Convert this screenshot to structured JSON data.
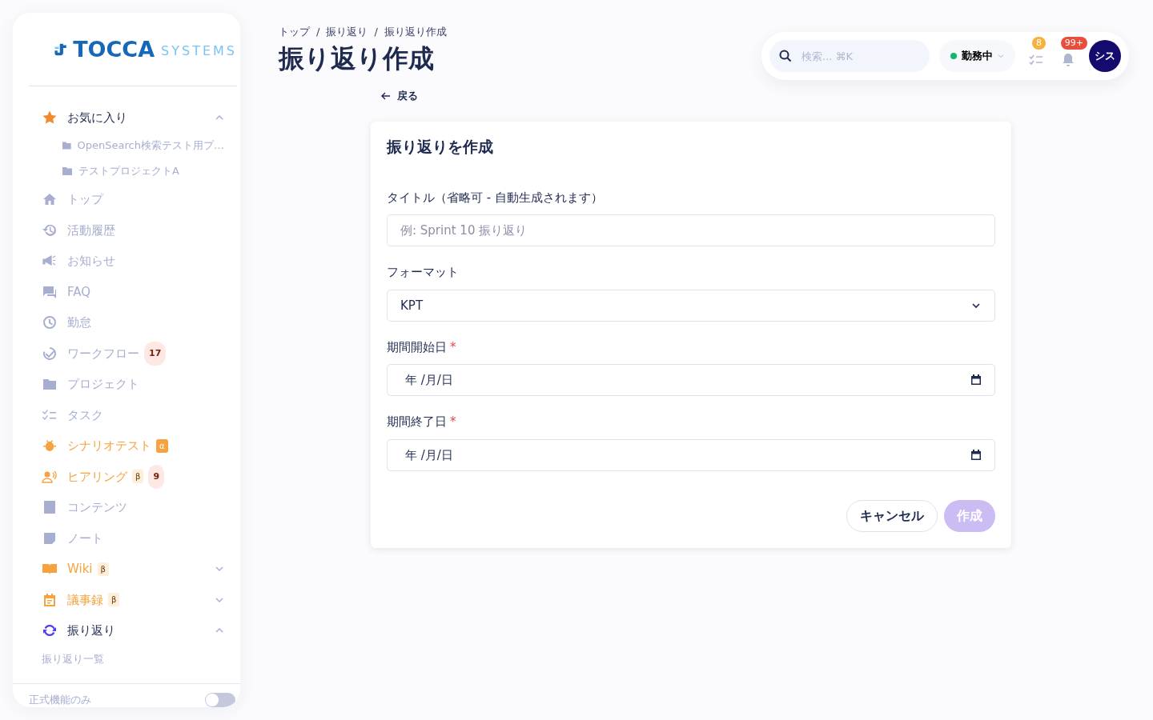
{
  "brand": {
    "name": "TOCCA",
    "sub": "SYSTEMS"
  },
  "sidebar": {
    "items": [
      {
        "kind": "group",
        "label": "お気に入り",
        "color": "#f08a2c",
        "expanded": true,
        "children": [
          {
            "label": "OpenSearch検索テスト用プ…"
          },
          {
            "label": "テストプロジェクトA"
          }
        ]
      },
      {
        "kind": "link",
        "label": "トップ",
        "color": "#a7aed0"
      },
      {
        "kind": "link",
        "label": "活動履歴",
        "color": "#a7aed0"
      },
      {
        "kind": "link",
        "label": "お知らせ",
        "color": "#a7aed0"
      },
      {
        "kind": "link",
        "label": "FAQ",
        "color": "#a7aed0"
      },
      {
        "kind": "link",
        "label": "勤怠",
        "color": "#a7aed0"
      },
      {
        "kind": "link",
        "label": "ワークフロー",
        "color": "#a7aed0",
        "count": "17"
      },
      {
        "kind": "link",
        "label": "プロジェクト",
        "color": "#a7aed0"
      },
      {
        "kind": "link",
        "label": "タスク",
        "color": "#a7aed0"
      },
      {
        "kind": "link",
        "label": "シナリオテスト",
        "color": "#f5a340",
        "tag": "α"
      },
      {
        "kind": "link",
        "label": "ヒアリング",
        "color": "#f5a340",
        "tag": "β",
        "count": "9"
      },
      {
        "kind": "link",
        "label": "コンテンツ",
        "color": "#a7aed0"
      },
      {
        "kind": "link",
        "label": "ノート",
        "color": "#a7aed0"
      },
      {
        "kind": "group",
        "label": "Wiki",
        "color": "#f5a340",
        "tag": "β",
        "expanded": false
      },
      {
        "kind": "group",
        "label": "議事録",
        "color": "#f5a340",
        "tag": "β",
        "expanded": false
      },
      {
        "kind": "group",
        "label": "振り返り",
        "color": "#4d3df5",
        "expanded": true,
        "children": [
          {
            "label": "振り返り一覧"
          }
        ]
      }
    ],
    "footer": {
      "label": "正式機能のみ",
      "on": false
    }
  },
  "breadcrumb": {
    "separator": "/",
    "items": [
      "トップ",
      "振り返り",
      "振り返り作成"
    ]
  },
  "page_title": "振り返り作成",
  "topbar": {
    "search": {
      "placeholder": "検索... ⌘K"
    },
    "status": "勤務中",
    "tasks_count": "8",
    "notifications_count": "99+",
    "avatar": "シス"
  },
  "back": "戻る",
  "form": {
    "title": "振り返りを作成",
    "required_mark": "*",
    "fields": [
      {
        "kind": "text",
        "label": "タイトル（省略可 - 自動生成されます）",
        "placeholder": "例: Sprint 10 振り返り",
        "required": false
      },
      {
        "kind": "select",
        "label": "フォーマット",
        "value": "KPT",
        "required": false
      },
      {
        "kind": "date",
        "label": "期間開始日",
        "value": "年 /月/日",
        "required": true
      },
      {
        "kind": "date",
        "label": "期間終了日",
        "value": "年 /月/日",
        "required": true
      }
    ],
    "buttons": [
      {
        "label": "キャンセル",
        "kind": "secondary",
        "disabled": false
      },
      {
        "label": "作成",
        "kind": "primary",
        "disabled": true
      }
    ]
  }
}
